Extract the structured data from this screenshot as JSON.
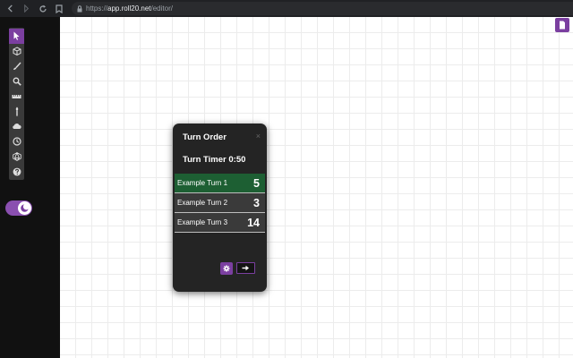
{
  "browser": {
    "url_prefix": "https://",
    "url_host": "app.roll20.net",
    "url_path": "/editor/",
    "icons": [
      "back-icon",
      "forward-icon",
      "reload-icon",
      "bookmark-icon",
      "lock-icon"
    ]
  },
  "toolbar": {
    "tools": [
      {
        "name": "select-tool",
        "icon": "pointer-icon",
        "active": true
      },
      {
        "name": "layers-tool",
        "icon": "cube-icon"
      },
      {
        "name": "draw-tool",
        "icon": "brush-icon"
      },
      {
        "name": "zoom-tool",
        "icon": "magnifier-icon"
      },
      {
        "name": "measure-tool",
        "icon": "ruler-icon"
      },
      {
        "name": "torch-tool",
        "icon": "torch-icon"
      },
      {
        "name": "fog-tool",
        "icon": "cloud-icon"
      },
      {
        "name": "turn-order-tool",
        "icon": "clock-icon"
      },
      {
        "name": "dice-tool",
        "icon": "d20-icon"
      },
      {
        "name": "help-tool",
        "icon": "help-icon"
      }
    ]
  },
  "theme_toggle": {
    "icon": "moon-icon",
    "state": "on"
  },
  "corner_button": {
    "icon": "document-icon"
  },
  "turn_order": {
    "title": "Turn Order",
    "close_glyph": "×",
    "timer_label": "Turn Timer 0:50",
    "turns": [
      {
        "name": "Example Turn 1",
        "initiative": "5",
        "current": true
      },
      {
        "name": "Example Turn 2",
        "initiative": "3",
        "current": false
      },
      {
        "name": "Example Turn 3",
        "initiative": "14",
        "current": false
      }
    ],
    "settings_icon": "gear-icon",
    "next_icon": "arrow-right-icon"
  },
  "colors": {
    "accent": "#7b3fa0",
    "current_turn": "#1d5f33",
    "panel": "#242424"
  }
}
